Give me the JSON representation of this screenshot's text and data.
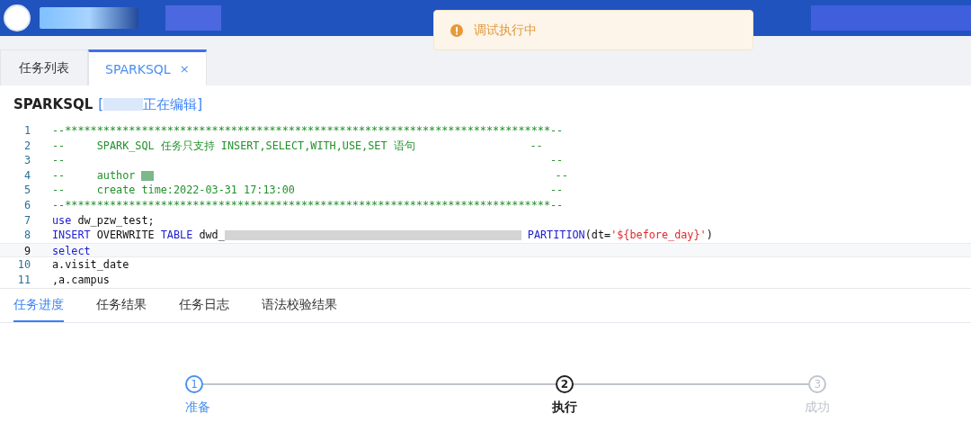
{
  "toast": {
    "kind": "warning",
    "text": "调试执行中"
  },
  "tabs": [
    {
      "label": "任务列表",
      "selected": false,
      "closable": false
    },
    {
      "label": "SPARKSQL",
      "selected": true,
      "closable": true,
      "close": "×"
    }
  ],
  "title": {
    "name": "SPARKSQL",
    "status": "正在编辑]",
    "bracket": "["
  },
  "editor": {
    "lines": [
      {
        "number": "1",
        "current": false,
        "segments": [
          {
            "kind": "comment",
            "text": "--****************************************************************************--"
          }
        ]
      },
      {
        "number": "2",
        "current": false,
        "segments": [
          {
            "kind": "comment",
            "text": "--     SPARK_SQL 任务只支持 INSERT,SELECT,WITH,USE,SET 语句                  --"
          }
        ]
      },
      {
        "number": "3",
        "current": false,
        "segments": [
          {
            "kind": "comment",
            "text": "--                                                                            --"
          }
        ]
      },
      {
        "number": "4",
        "current": false,
        "segments": [
          {
            "kind": "comment",
            "text": "--     author "
          },
          {
            "kind": "redacted"
          },
          {
            "kind": "comment",
            "text": "                                                            --"
          }
        ]
      },
      {
        "number": "5",
        "current": false,
        "segments": [
          {
            "kind": "comment",
            "text": "--     create time:2022-03-31 17:13:00                                        --"
          }
        ]
      },
      {
        "number": "6",
        "current": false,
        "segments": [
          {
            "kind": "comment",
            "text": "--****************************************************************************--"
          }
        ]
      },
      {
        "number": "7",
        "current": false,
        "segments": [
          {
            "kind": "keyword",
            "text": "use"
          },
          {
            "kind": "plain",
            "text": " dw_pzw_test;"
          }
        ]
      },
      {
        "number": "8",
        "current": false,
        "segments": [
          {
            "kind": "keyword",
            "text": "INSERT"
          },
          {
            "kind": "plain",
            "text": " OVERWRITE "
          },
          {
            "kind": "keyword",
            "text": "TABLE"
          },
          {
            "kind": "plain",
            "text": " dwd_"
          },
          {
            "kind": "redacted"
          },
          {
            "kind": "keyword",
            "text": "PARTITION"
          },
          {
            "kind": "plain",
            "text": "(dt="
          },
          {
            "kind": "string",
            "text": "'${before_day}'"
          },
          {
            "kind": "plain",
            "text": ")"
          }
        ]
      },
      {
        "number": "9",
        "current": true,
        "segments": [
          {
            "kind": "keyword",
            "text": "select"
          }
        ]
      },
      {
        "number": "10",
        "current": false,
        "segments": [
          {
            "kind": "plain",
            "text": "a.visit_date"
          }
        ]
      },
      {
        "number": "11",
        "current": false,
        "segments": [
          {
            "kind": "plain",
            "text": ",a.campus"
          }
        ]
      }
    ]
  },
  "result_tabs": [
    {
      "label": "任务进度",
      "selected": true
    },
    {
      "label": "任务结果",
      "selected": false
    },
    {
      "label": "任务日志",
      "selected": false
    },
    {
      "label": "语法校验结果",
      "selected": false
    }
  ],
  "steps": [
    {
      "number": "1",
      "label": "准备",
      "finished": true,
      "current": false
    },
    {
      "number": "2",
      "label": "执行",
      "finished": false,
      "current": true
    },
    {
      "number": "3",
      "label": "成功",
      "finished": false,
      "current": false
    }
  ]
}
